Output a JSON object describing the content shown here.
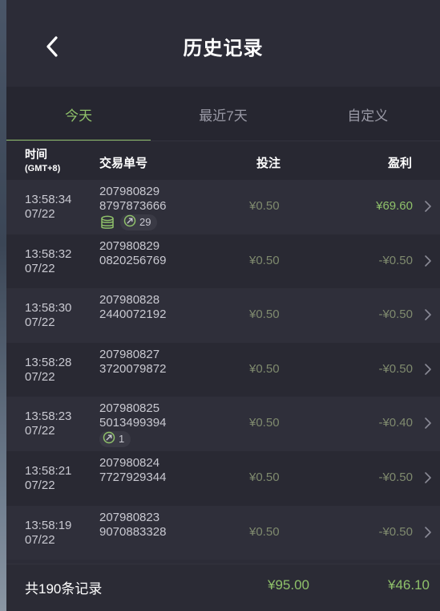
{
  "header": {
    "title": "历史记录",
    "back_icon": "chevron-left-icon"
  },
  "tabs": [
    {
      "label": "今天",
      "active": true
    },
    {
      "label": "最近7天",
      "active": false
    },
    {
      "label": "自定义",
      "active": false
    }
  ],
  "columns": {
    "time": "时间",
    "timezone": "(GMT+8)",
    "order": "交易单号",
    "bet": "投注",
    "profit": "盈利"
  },
  "rows": [
    {
      "time": "13:58:34",
      "date": "07/22",
      "order_1": "207980829",
      "order_2": "8797873666",
      "bet": "¥0.50",
      "profit": "¥69.60",
      "win": true,
      "coin_badge": true,
      "link_count": "29"
    },
    {
      "time": "13:58:32",
      "date": "07/22",
      "order_1": "207980829",
      "order_2": "0820256769",
      "bet": "¥0.50",
      "profit": "-¥0.50",
      "win": false
    },
    {
      "time": "13:58:30",
      "date": "07/22",
      "order_1": "207980828",
      "order_2": "2440072192",
      "bet": "¥0.50",
      "profit": "-¥0.50",
      "win": false
    },
    {
      "time": "13:58:28",
      "date": "07/22",
      "order_1": "207980827",
      "order_2": "3720079872",
      "bet": "¥0.50",
      "profit": "-¥0.50",
      "win": false
    },
    {
      "time": "13:58:23",
      "date": "07/22",
      "order_1": "207980825",
      "order_2": "5013499394",
      "bet": "¥0.50",
      "profit": "-¥0.40",
      "win": false,
      "link_count": "1"
    },
    {
      "time": "13:58:21",
      "date": "07/22",
      "order_1": "207980824",
      "order_2": "7727929344",
      "bet": "¥0.50",
      "profit": "-¥0.50",
      "win": false
    },
    {
      "time": "13:58:19",
      "date": "07/22",
      "order_1": "207980823",
      "order_2": "9070883328",
      "bet": "¥0.50",
      "profit": "-¥0.50",
      "win": false
    }
  ],
  "footer": {
    "total": "共190条记录",
    "sum_bet": "¥95.00",
    "sum_profit": "¥46.10"
  },
  "colors": {
    "accent_green": "#8fc16a",
    "muted_green": "#7f8a6e",
    "background": "#2c2c37"
  }
}
